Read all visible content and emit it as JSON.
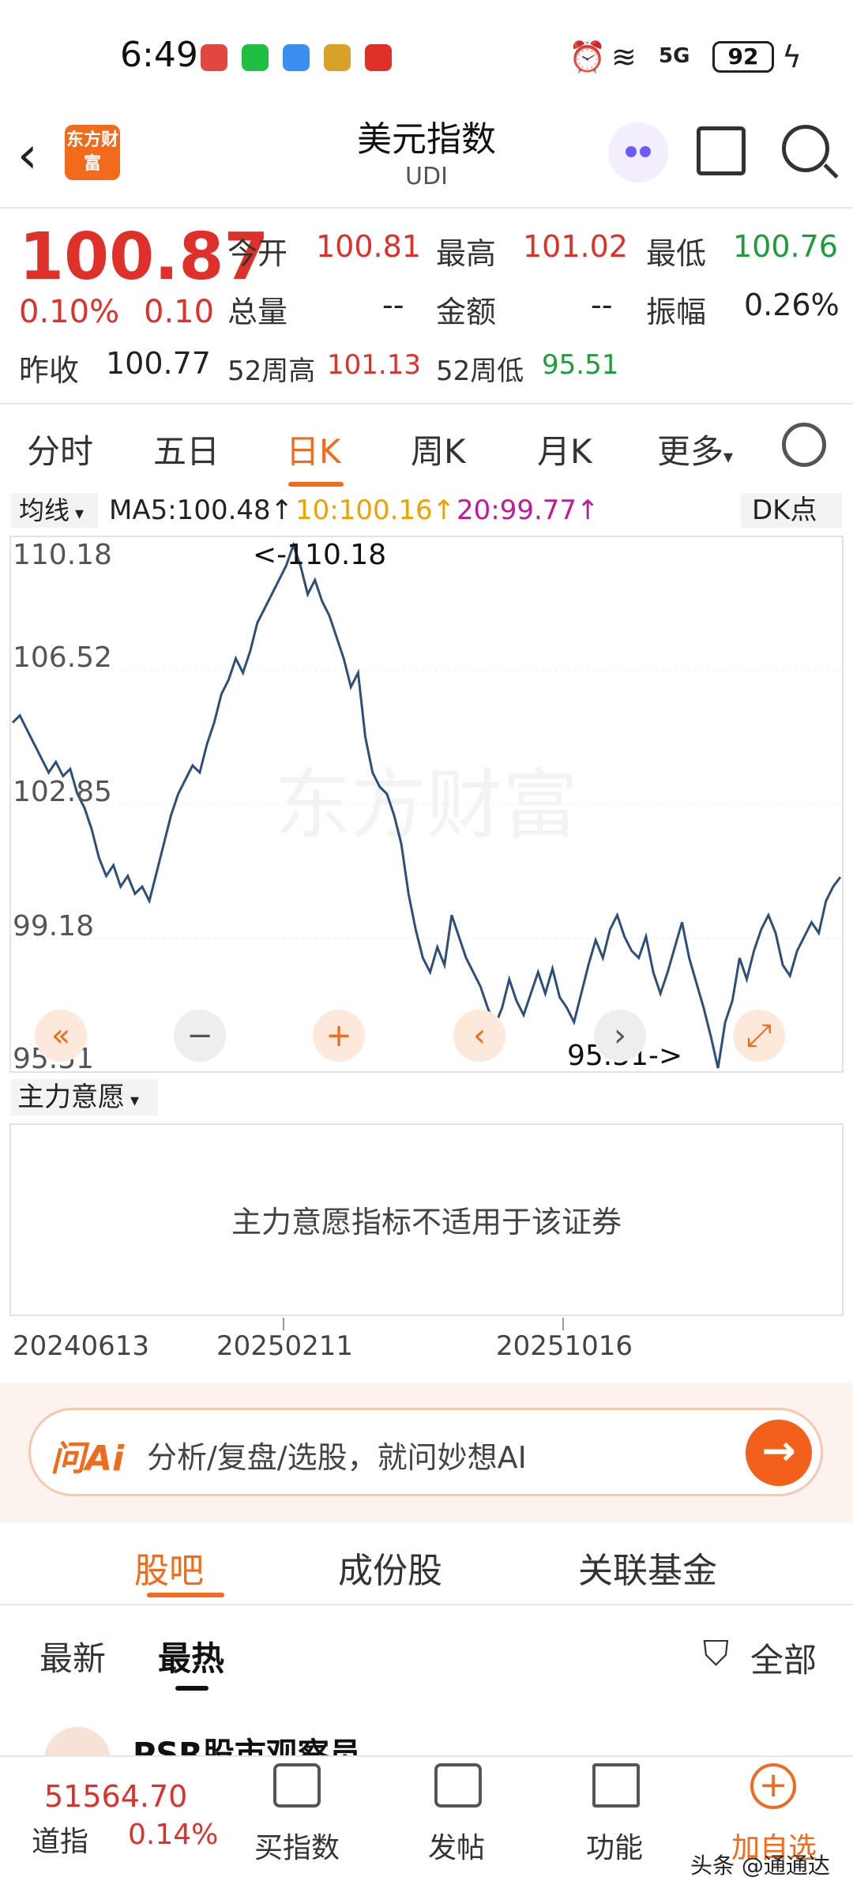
{
  "status": {
    "time": "6:49",
    "battery": "92",
    "network": "5G"
  },
  "header": {
    "title": "美元指数",
    "code": "UDI",
    "logo_text": "东方财富"
  },
  "quote": {
    "price": "100.87",
    "change_pct": "0.10%",
    "change": "0.10",
    "open_label": "今开",
    "open": "100.81",
    "high_label": "最高",
    "high": "101.02",
    "low_label": "最低",
    "low": "100.76",
    "volume_label": "总量",
    "volume": "--",
    "amount_label": "金额",
    "amount": "--",
    "amplitude_label": "振幅",
    "amplitude": "0.26%",
    "prev_close_label": "昨收",
    "prev_close": "100.77",
    "wk52_high_label": "52周高",
    "wk52_high": "101.13",
    "wk52_low_label": "52周低",
    "wk52_low": "95.51"
  },
  "ktabs": [
    "分时",
    "五日",
    "日K",
    "周K",
    "月K",
    "更多"
  ],
  "ma": {
    "selector": "均线",
    "ma5": "MA5:100.48↑",
    "ma10": "10:100.16↑",
    "ma20": "20:99.77↑",
    "dk": "DK点"
  },
  "colors": {
    "accent": "#f26a1b",
    "up": "#e0302a",
    "down": "#1a9e3a",
    "ma10": "#f0a000",
    "ma20": "#c2189a",
    "line": "#2d4f7a"
  },
  "chart_data": {
    "type": "line",
    "y_ticks": [
      "110.18",
      "106.52",
      "102.85",
      "99.18",
      "95.51"
    ],
    "ylim": [
      95.51,
      110.18
    ],
    "max_annotation": "<-110.18",
    "min_annotation": "95.51->",
    "x_ticks": [
      "20240613",
      "20250211",
      "20251016"
    ],
    "watermark": "东方财富",
    "series": [
      {
        "values": [
          105.2,
          105.4,
          105.0,
          104.6,
          104.2,
          103.8,
          104.1,
          103.7,
          103.9,
          103.2,
          102.8,
          102.2,
          101.4,
          100.9,
          101.2,
          100.6,
          100.9,
          100.4,
          100.6,
          100.2,
          101.0,
          101.8,
          102.6,
          103.2,
          103.6,
          104.0,
          103.8,
          104.6,
          105.2,
          106.0,
          106.4,
          107.0,
          106.6,
          107.2,
          108.0,
          108.4,
          108.8,
          109.2,
          109.6,
          110.18,
          109.6,
          108.8,
          109.2,
          108.6,
          108.2,
          107.6,
          107.0,
          106.2,
          106.6,
          104.8,
          103.8,
          103.4,
          103.2,
          102.6,
          101.8,
          100.4,
          99.4,
          98.6,
          98.2,
          98.9,
          98.4,
          99.8,
          99.2,
          98.6,
          98.2,
          97.8,
          97.2,
          96.7,
          97.2,
          98.0,
          97.4,
          97.0,
          97.6,
          98.2,
          97.6,
          98.3,
          97.5,
          97.2,
          96.8,
          97.6,
          98.4,
          99.1,
          98.6,
          99.4,
          99.8,
          99.2,
          98.8,
          98.6,
          99.2,
          98.2,
          97.6,
          98.2,
          98.9,
          99.6,
          98.6,
          97.9,
          97.2,
          96.4,
          95.51,
          96.8,
          97.4,
          98.6,
          98.0,
          98.8,
          99.4,
          99.8,
          99.3,
          98.4,
          98.1,
          98.8,
          99.2,
          99.6,
          99.3,
          100.2,
          100.6,
          100.87
        ]
      }
    ]
  },
  "controls": [
    "«",
    "−",
    "+",
    "‹",
    "›",
    "⤢"
  ],
  "main_force": {
    "selector": "主力意愿",
    "message": "主力意愿指标不适用于该证券"
  },
  "ai": {
    "logo": "问Ai",
    "placeholder": "分析/复盘/选股，就问妙想AI"
  },
  "section_tabs": [
    "股吧",
    "成份股",
    "关联基金"
  ],
  "sub_tabs": [
    "最新",
    "最热"
  ],
  "filter": "全部",
  "post": {
    "author": "PSR股市观察员"
  },
  "bottom": {
    "index_value": "51564.70",
    "index_name": "道指",
    "index_pct": "0.14%",
    "items": [
      "买指数",
      "发帖",
      "功能",
      "加自选"
    ]
  },
  "footer_mark": "头条 @通通达"
}
